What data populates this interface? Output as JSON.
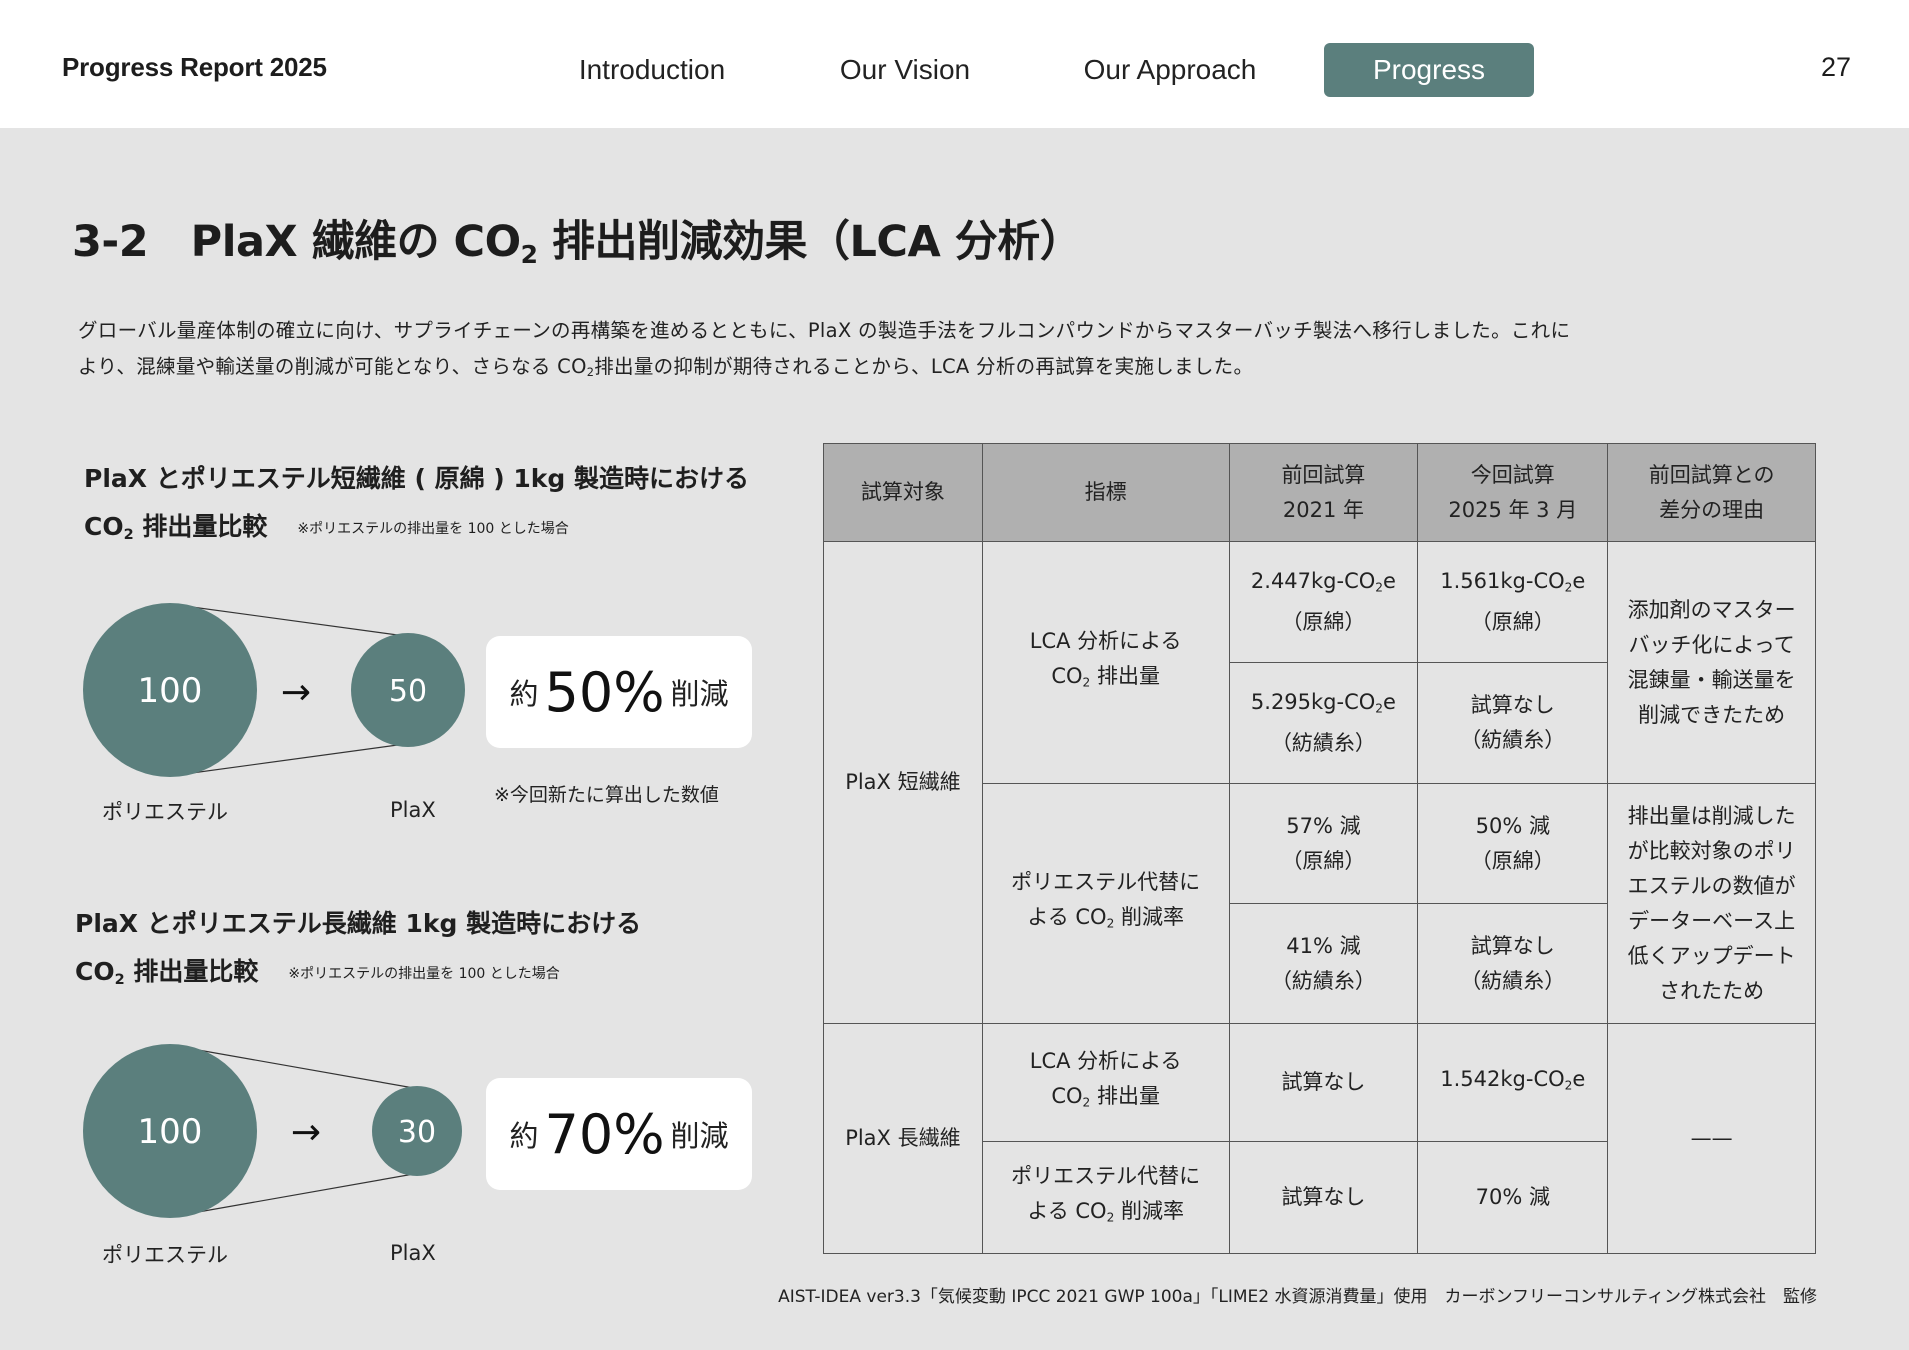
{
  "header": {
    "brand": "Progress Report 2025",
    "nav": [
      "Introduction",
      "Our Vision",
      "Our Approach",
      "Progress"
    ],
    "active_nav": "Progress",
    "page_number": "27"
  },
  "title": {
    "prefix": "3-2　PlaX 繊維の CO",
    "sub": "2",
    "suffix": " 排出削減効果（LCA 分析）"
  },
  "intro": {
    "line1": "グローバル量産体制の確立に向け、サプライチェーンの再構築を進めるとともに、PlaX の製造手法をフルコンパウンドからマスターバッチ製法へ移行しました。これに",
    "line2_a": "より、混練量や輸送量の削減が可能となり、さらなる CO",
    "line2_sub": "2",
    "line2_b": "排出量の抑制が期待されることから、LCA 分析の再試算を実施しました。"
  },
  "short_fiber": {
    "heading_line1": "PlaX とポリエステル短繊維 ( 原綿 ) 1kg 製造時における",
    "heading_line2_a": "CO",
    "heading_line2_sub": "2",
    "heading_line2_b": " 排出量比較",
    "note": "※ポリエステルの排出量を 100 とした場合",
    "polyester_value": "100",
    "arrow": "→",
    "plax_value": "50",
    "reduce_prefix": "約",
    "reduce_percent": "50%",
    "reduce_suffix": "削減",
    "polyester_label": "ポリエステル",
    "plax_label": "PlaX",
    "footnote": "※今回新たに算出した数値"
  },
  "long_fiber": {
    "heading_line1": "PlaX とポリエステル長繊維 1kg 製造時における",
    "heading_line2_a": "CO",
    "heading_line2_sub": "2",
    "heading_line2_b": " 排出量比較",
    "note": "※ポリエステルの排出量を 100 とした場合",
    "polyester_value": "100",
    "arrow": "→",
    "plax_value": "30",
    "reduce_prefix": "約",
    "reduce_percent": "70%",
    "reduce_suffix": "削減",
    "polyester_label": "ポリエステル",
    "plax_label": "PlaX"
  },
  "table": {
    "headers": {
      "target": "試算対象",
      "indicator": "指標",
      "prev_line1": "前回試算",
      "prev_line2": "2021 年",
      "curr_line1": "今回試算",
      "curr_line2": "2025 年 3 月",
      "reason_line1": "前回試算との",
      "reason_line2": "差分の理由"
    },
    "short_fiber": {
      "target": "PlaX 短繊維",
      "lca_indicator_line1": "LCA 分析による",
      "lca_indicator_line2_a": "CO",
      "lca_indicator_line2_sub": "2",
      "lca_indicator_line2_b": " 排出量",
      "r1_prev_a": "2.447kg-CO",
      "r1_prev_sub": "2",
      "r1_prev_b": "e",
      "r1_prev_note": "（原綿）",
      "r1_curr_a": "1.561kg-CO",
      "r1_curr_sub": "2",
      "r1_curr_b": "e",
      "r1_curr_note": "（原綿）",
      "r2_prev_a": "5.295kg-CO",
      "r2_prev_sub": "2",
      "r2_prev_b": "e",
      "r2_prev_note": "（紡績糸）",
      "r2_curr": "試算なし",
      "r2_curr_note": "（紡績糸）",
      "reason1_l1": "添加剤のマスター",
      "reason1_l2": "バッチ化によって",
      "reason1_l3": "混錬量・輸送量を",
      "reason1_l4": "削減できたため",
      "sub_indicator_line1": "ポリエステル代替に",
      "sub_indicator_line2_a": "よる CO",
      "sub_indicator_line2_sub": "2",
      "sub_indicator_line2_b": " 削減率",
      "r3_prev": "57% 減",
      "r3_prev_note": "（原綿）",
      "r3_curr": "50% 減",
      "r3_curr_note": "（原綿）",
      "r4_prev": "41% 減",
      "r4_prev_note": "（紡績糸）",
      "r4_curr": "試算なし",
      "r4_curr_note": "（紡績糸）",
      "reason2_l1": "排出量は削減した",
      "reason2_l2": "が比較対象のポリ",
      "reason2_l3": "エステルの数値が",
      "reason2_l4": "データーベース上",
      "reason2_l5": "低くアップデート",
      "reason2_l6": "されたため"
    },
    "long_fiber": {
      "target": "PlaX 長繊維",
      "lca_indicator_line1": "LCA 分析による",
      "lca_indicator_line2_a": "CO",
      "lca_indicator_line2_sub": "2",
      "lca_indicator_line2_b": " 排出量",
      "r1_prev": "試算なし",
      "r1_curr_a": "1.542kg-CO",
      "r1_curr_sub": "2",
      "r1_curr_b": "e",
      "sub_indicator_line1": "ポリエステル代替に",
      "sub_indicator_line2_a": "よる CO",
      "sub_indicator_line2_sub": "2",
      "sub_indicator_line2_b": " 削減率",
      "r2_prev": "試算なし",
      "r2_curr": "70% 減",
      "reason": "——"
    }
  },
  "source": "AIST-IDEA ver3.3「気候変動 IPCC 2021 GWP 100a」「LIME2 水資源消費量」使用　カーボンフリーコンサルティング株式会社　監修",
  "colors": {
    "accent": "#5b7f7d",
    "background": "#e4e4e4",
    "table_header": "#b0b0b0"
  }
}
